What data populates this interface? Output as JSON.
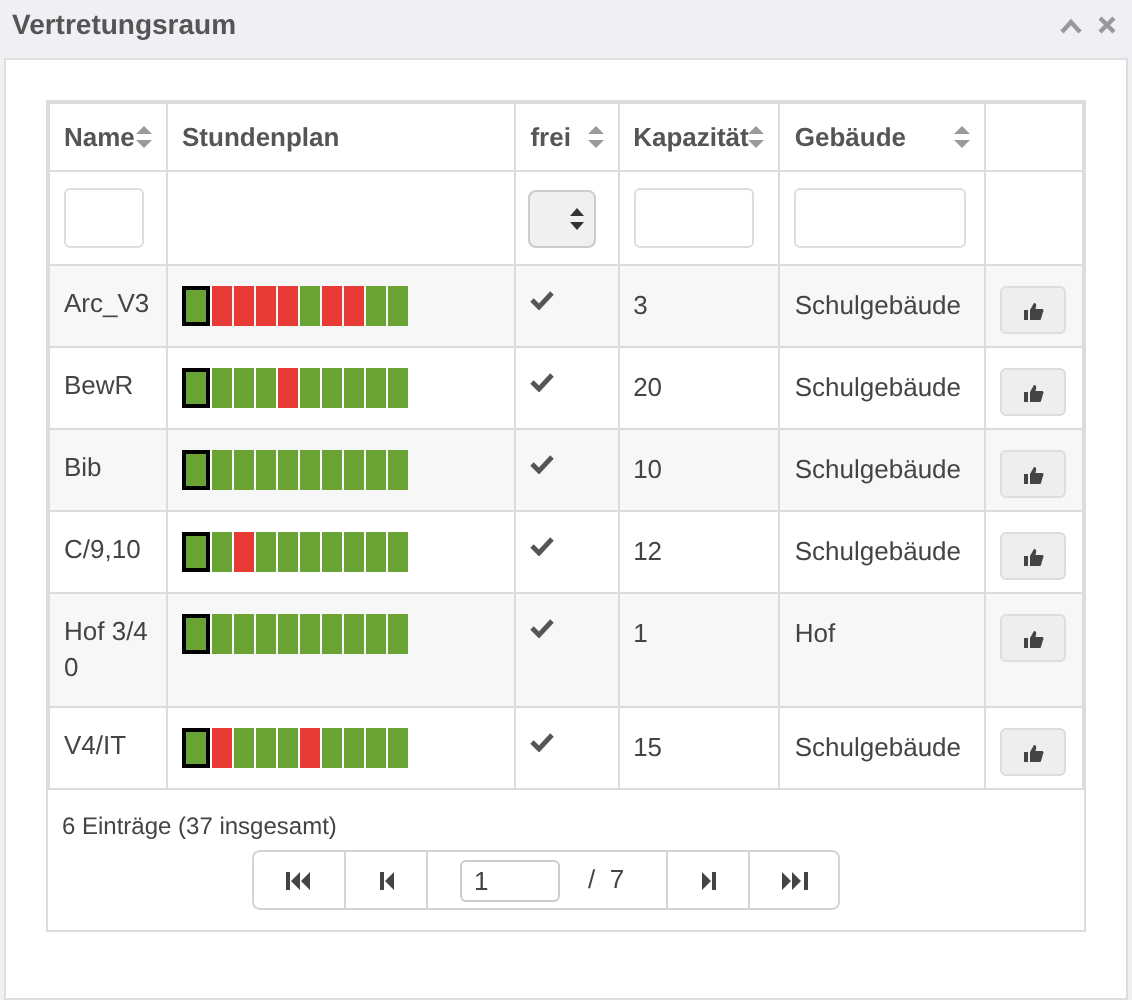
{
  "window": {
    "title": "Vertretungsraum"
  },
  "columns": [
    {
      "label": "Name",
      "sortable": true
    },
    {
      "label": "Stundenplan",
      "sortable": false
    },
    {
      "label": "frei",
      "sortable": true
    },
    {
      "label": "Kapazität",
      "sortable": true
    },
    {
      "label": "Gebäude",
      "sortable": true
    },
    {
      "sortable": false
    }
  ],
  "rows": [
    {
      "name": "Arc_V3",
      "slots": [
        {
          "free": true,
          "current": true
        },
        {
          "free": false,
          "current": false
        },
        {
          "free": false,
          "current": false
        },
        {
          "free": false,
          "current": false
        },
        {
          "free": false,
          "current": false
        },
        {
          "free": true,
          "current": false
        },
        {
          "free": false,
          "current": false
        },
        {
          "free": false,
          "current": false
        },
        {
          "free": true,
          "current": false
        },
        {
          "free": true,
          "current": false
        }
      ],
      "free": true,
      "capacity": "3",
      "building": "Schulgebäude"
    },
    {
      "name": "BewR",
      "slots": [
        {
          "free": true,
          "current": true
        },
        {
          "free": true,
          "current": false
        },
        {
          "free": true,
          "current": false
        },
        {
          "free": true,
          "current": false
        },
        {
          "free": false,
          "current": false
        },
        {
          "free": true,
          "current": false
        },
        {
          "free": true,
          "current": false
        },
        {
          "free": true,
          "current": false
        },
        {
          "free": true,
          "current": false
        },
        {
          "free": true,
          "current": false
        }
      ],
      "free": true,
      "capacity": "20",
      "building": "Schulgebäude"
    },
    {
      "name": "Bib",
      "slots": [
        {
          "free": true,
          "current": true
        },
        {
          "free": true,
          "current": false
        },
        {
          "free": true,
          "current": false
        },
        {
          "free": true,
          "current": false
        },
        {
          "free": true,
          "current": false
        },
        {
          "free": true,
          "current": false
        },
        {
          "free": true,
          "current": false
        },
        {
          "free": true,
          "current": false
        },
        {
          "free": true,
          "current": false
        },
        {
          "free": true,
          "current": false
        }
      ],
      "free": true,
      "capacity": "10",
      "building": "Schulgebäude"
    },
    {
      "name": "C/9,10",
      "slots": [
        {
          "free": true,
          "current": true
        },
        {
          "free": true,
          "current": false
        },
        {
          "free": false,
          "current": false
        },
        {
          "free": true,
          "current": false
        },
        {
          "free": true,
          "current": false
        },
        {
          "free": true,
          "current": false
        },
        {
          "free": true,
          "current": false
        },
        {
          "free": true,
          "current": false
        },
        {
          "free": true,
          "current": false
        },
        {
          "free": true,
          "current": false
        }
      ],
      "free": true,
      "capacity": "12",
      "building": "Schulgebäude"
    },
    {
      "name": "Hof 3/4 0",
      "slots": [
        {
          "free": true,
          "current": true
        },
        {
          "free": true,
          "current": false
        },
        {
          "free": true,
          "current": false
        },
        {
          "free": true,
          "current": false
        },
        {
          "free": true,
          "current": false
        },
        {
          "free": true,
          "current": false
        },
        {
          "free": true,
          "current": false
        },
        {
          "free": true,
          "current": false
        },
        {
          "free": true,
          "current": false
        },
        {
          "free": true,
          "current": false
        }
      ],
      "free": true,
      "capacity": "1",
      "building": "Hof"
    },
    {
      "name": "V4/IT",
      "slots": [
        {
          "free": true,
          "current": true
        },
        {
          "free": false,
          "current": false
        },
        {
          "free": true,
          "current": false
        },
        {
          "free": true,
          "current": false
        },
        {
          "free": true,
          "current": false
        },
        {
          "free": false,
          "current": false
        },
        {
          "free": true,
          "current": false
        },
        {
          "free": true,
          "current": false
        },
        {
          "free": true,
          "current": false
        },
        {
          "free": true,
          "current": false
        }
      ],
      "free": true,
      "capacity": "15",
      "building": "Schulgebäude"
    }
  ],
  "summary": "6 Einträge (37 insgesamt)",
  "pager": {
    "page": "1",
    "total": "/  7"
  }
}
